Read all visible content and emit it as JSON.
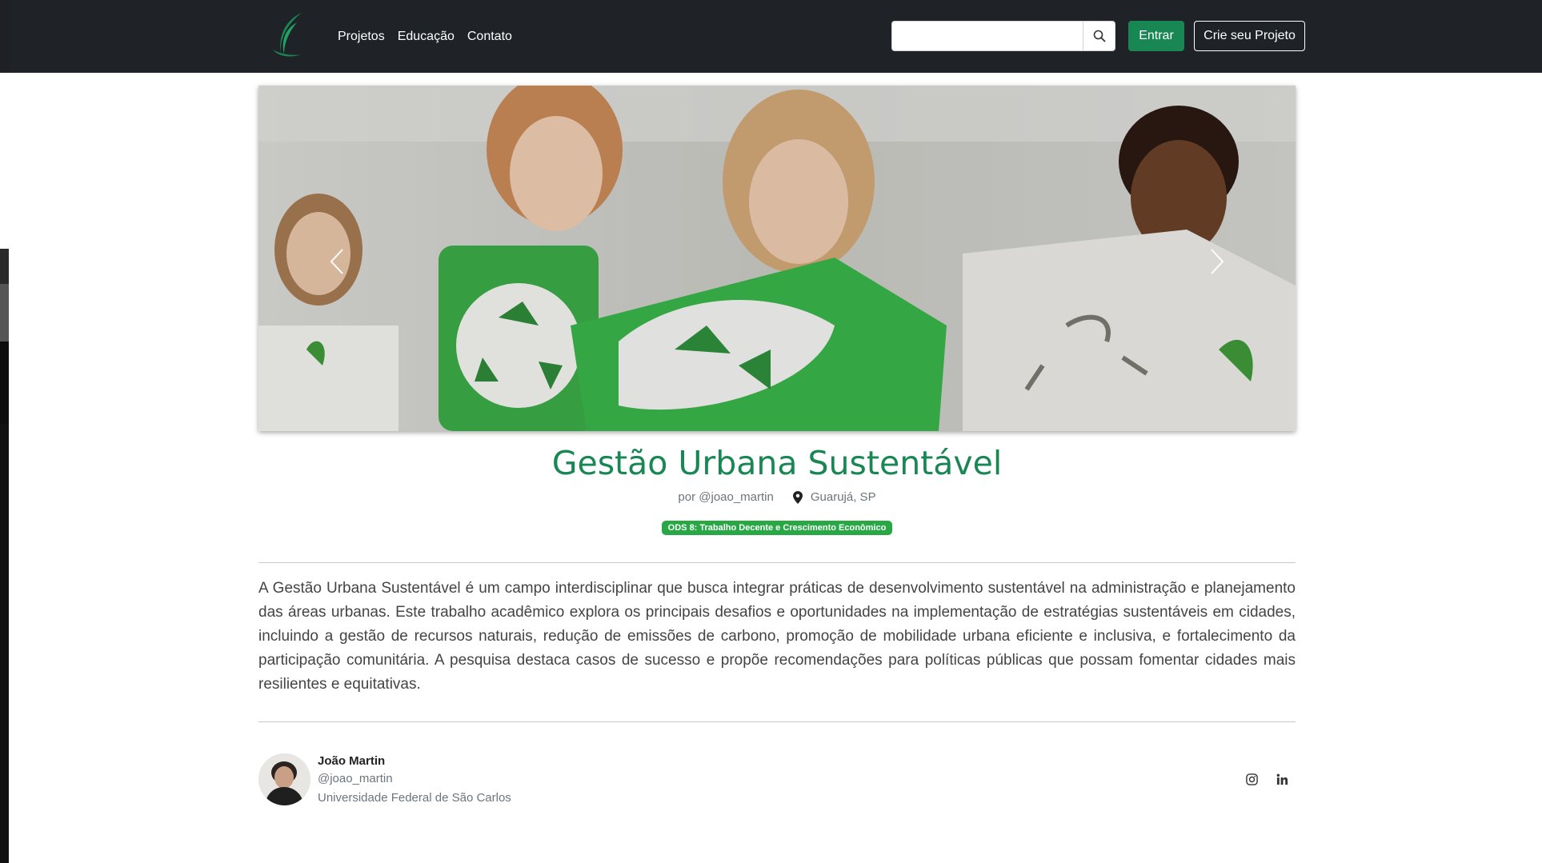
{
  "nav": {
    "links": [
      "Projetos",
      "Educação",
      "Contato"
    ],
    "search_placeholder": "",
    "login_label": "Entrar",
    "create_label": "Crie seu Projeto"
  },
  "project": {
    "title": "Gestão Urbana Sustentável",
    "author_prefix": "por @joao_martin",
    "location": "Guarujá, SP",
    "badge": "ODS 8: Trabalho Decente e Crescimento Econômico",
    "description": "A Gestão Urbana Sustentável é um campo interdisciplinar que busca integrar práticas de desenvolvimento sustentável na administração e planejamento das áreas urbanas. Este trabalho acadêmico explora os principais desafios e oportunidades na implementação de estratégias sustentáveis em cidades, incluindo a gestão de recursos naturais, redução de emissões de carbono, promoção de mobilidade urbana eficiente e inclusiva, e fortalecimento da participação comunitária. A pesquisa destaca casos de sucesso e propõe recomendações para políticas públicas que possam fomentar cidades mais resilientes e equitativas."
  },
  "author": {
    "name": "João Martin",
    "handle": "@joao_martin",
    "university": "Universidade Federal de São Carlos"
  },
  "colors": {
    "brand_green": "#198754",
    "navbar_bg": "#1f2227",
    "badge_green": "#28a745"
  },
  "icons": {
    "search": "search-icon",
    "location": "map-pin-icon",
    "instagram": "instagram-icon",
    "linkedin": "linkedin-icon",
    "prev": "chevron-left-icon",
    "next": "chevron-right-icon"
  }
}
